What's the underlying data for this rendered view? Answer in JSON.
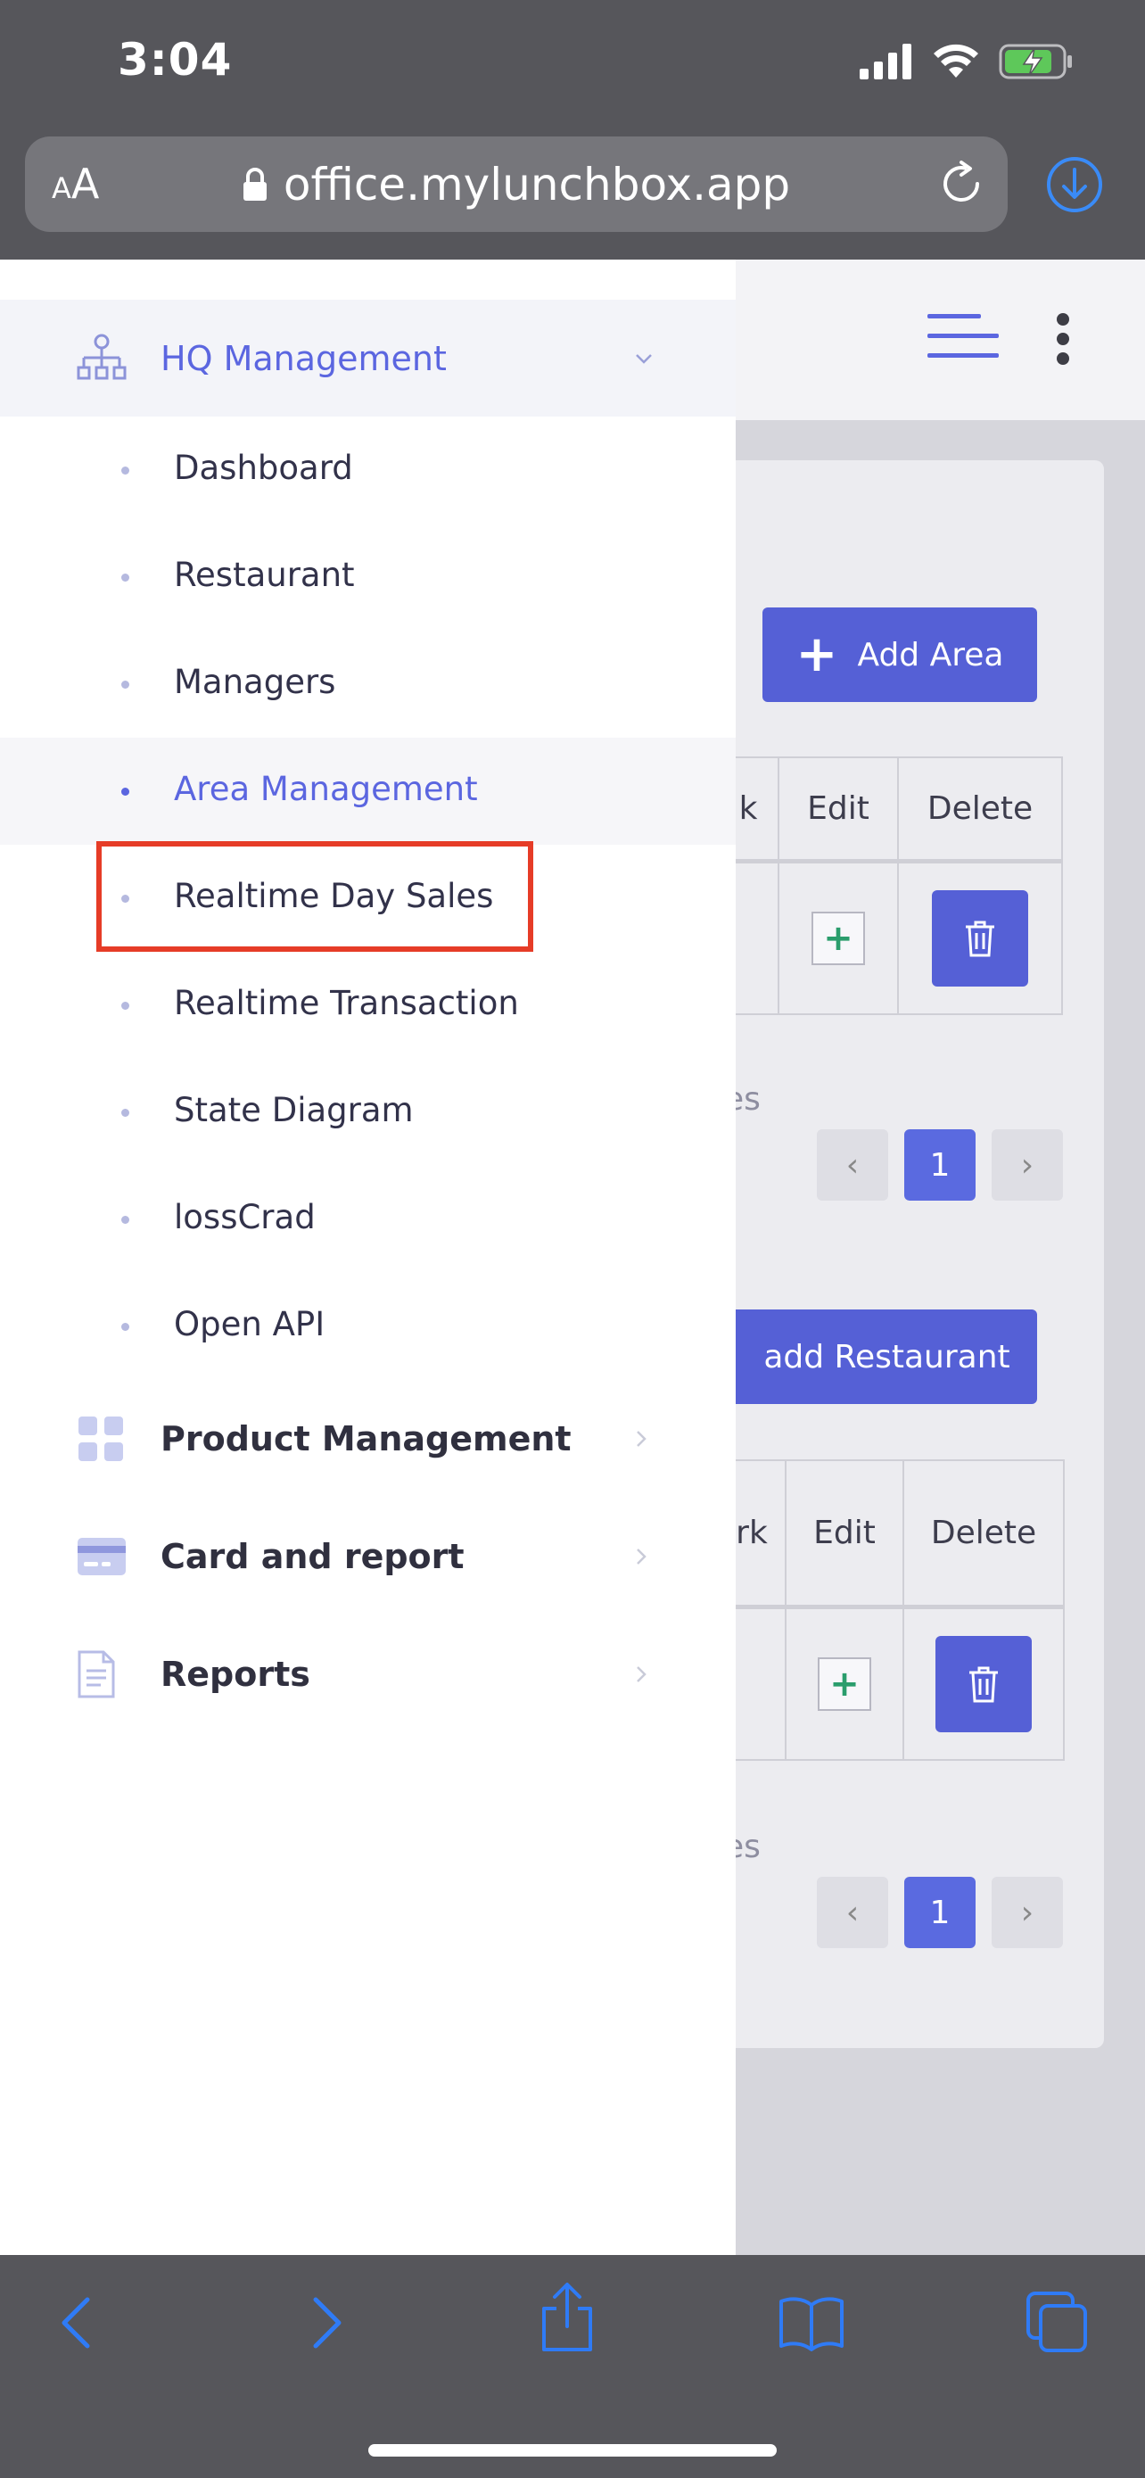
{
  "status_bar": {
    "time": "3:04"
  },
  "browser": {
    "text_size_label_small": "A",
    "text_size_label_large": "A",
    "url": "office.mylunchbox.app"
  },
  "page": {
    "area_section": {
      "add_button_label": "Add Area",
      "col_remark_fragment": "k",
      "col_edit": "Edit",
      "col_delete": "Delete",
      "entries_fragment": "es",
      "page_number": "1"
    },
    "restaurant_section": {
      "add_button_label": "add Restaurant",
      "col_remark_fragment": "rk",
      "col_edit": "Edit",
      "col_delete": "Delete",
      "entries_fragment": "es",
      "page_number": "1"
    }
  },
  "sidebar": {
    "groups": [
      {
        "label": "HQ Management",
        "icon": "sitemap-icon",
        "expanded": true
      },
      {
        "label": "Product Management",
        "icon": "grid-icon",
        "expanded": false
      },
      {
        "label": "Card and report",
        "icon": "credit-card-icon",
        "expanded": false
      },
      {
        "label": "Reports",
        "icon": "document-icon",
        "expanded": false
      }
    ],
    "hq_items": [
      {
        "label": "Dashboard"
      },
      {
        "label": "Restaurant"
      },
      {
        "label": "Managers"
      },
      {
        "label": "Area Management",
        "current": true
      },
      {
        "label": "Realtime Day Sales",
        "highlighted": true
      },
      {
        "label": "Realtime Transaction"
      },
      {
        "label": "State Diagram"
      },
      {
        "label": "lossCrad"
      },
      {
        "label": "Open API"
      }
    ]
  },
  "colors": {
    "accent": "#5b66e0",
    "button": "#5560d6",
    "highlight": "#e63c27",
    "chrome": "#56565b",
    "ios_blue": "#2f7bf6"
  }
}
